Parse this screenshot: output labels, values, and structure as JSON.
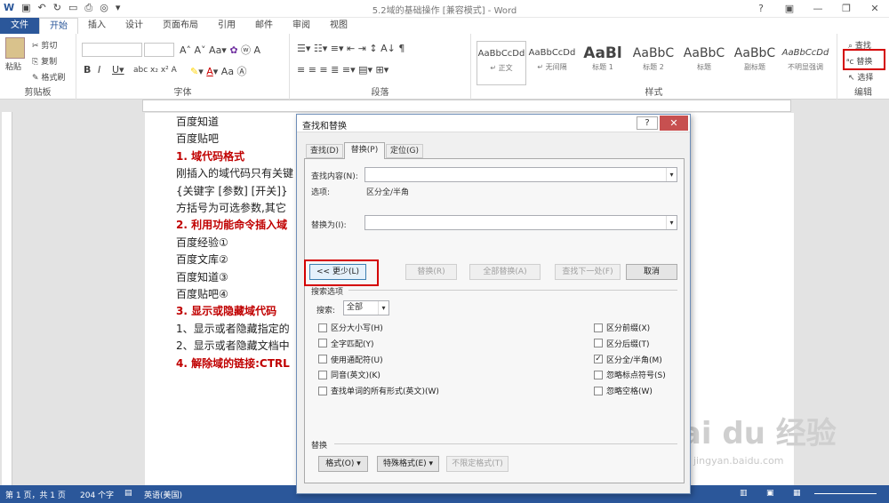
{
  "window": {
    "title": "5.2域的基础操作 [兼容模式] - Word"
  },
  "tabs": [
    "文件",
    "开始",
    "插入",
    "设计",
    "页面布局",
    "引用",
    "邮件",
    "审阅",
    "视图"
  ],
  "ribbon": {
    "clipboard": {
      "label": "剪贴板",
      "paste": "粘贴",
      "cut": "剪切",
      "copy": "复制",
      "format_painter": "格式刷"
    },
    "font": {
      "label": "字体"
    },
    "paragraph": {
      "label": "段落"
    },
    "styles": {
      "label": "样式",
      "items": [
        {
          "preview": "AaBbCcDd",
          "name": "↵ 正文"
        },
        {
          "preview": "AaBbCcDd",
          "name": "↵ 无间隔"
        },
        {
          "preview": "AaBl",
          "name": "标题 1"
        },
        {
          "preview": "AaBbC",
          "name": "标题 2"
        },
        {
          "preview": "AaBbC",
          "name": "标题"
        },
        {
          "preview": "AaBbC",
          "name": "副标题"
        },
        {
          "preview": "AaBbCcDd",
          "name": "不明显强调"
        }
      ]
    },
    "editing": {
      "label": "编辑",
      "find": "查找",
      "replace": "替换",
      "select": "选择"
    }
  },
  "document": {
    "lines": [
      {
        "text": "百度知道",
        "style": "normal"
      },
      {
        "text": "百度贴吧",
        "style": "normal"
      },
      {
        "text": "1.    域代码格式",
        "style": "red"
      },
      {
        "text": "刚插入的域代码只有关键",
        "style": "normal"
      },
      {
        "text": "{关键字  [参数] [开关]}",
        "style": "normal"
      },
      {
        "text": "方括号为可选参数,其它",
        "style": "normal"
      },
      {
        "text": "2.    利用功能命令插入域",
        "style": "red"
      },
      {
        "text": "百度经验①",
        "style": "normal"
      },
      {
        "text": "百度文库②",
        "style": "normal"
      },
      {
        "text": "百度知道③",
        "style": "normal"
      },
      {
        "text": "百度贴吧④",
        "style": "normal"
      },
      {
        "text": "3.    显示或隐藏域代码",
        "style": "red"
      },
      {
        "text": "1、显示或者隐藏指定的",
        "style": "normal"
      },
      {
        "text": "2、显示或者隐藏文档中",
        "style": "normal"
      },
      {
        "text": "4.    解除域的链接:CTRL",
        "style": "red"
      }
    ]
  },
  "status": {
    "page": "第 1 页，共 1 页",
    "words": "204 个字",
    "lang": "英语(美国)"
  },
  "dialog": {
    "title": "查找和替换",
    "help": "?",
    "tabs": [
      "查找(D)",
      "替换(P)",
      "定位(G)"
    ],
    "find_label": "查找内容(N):",
    "find_value": "",
    "options_label": "选项:",
    "options_value": "区分全/半角",
    "replace_label": "替换为(I):",
    "replace_value": "",
    "buttons": {
      "less": "<< 更少(L)",
      "replace": "替换(R)",
      "replace_all": "全部替换(A)",
      "find_next": "查找下一处(F)",
      "cancel": "取消"
    },
    "search_options_label": "搜索选项",
    "search_label": "搜索:",
    "search_value": "全部",
    "left_checks": [
      {
        "label": "区分大小写(H)",
        "checked": false
      },
      {
        "label": "全字匹配(Y)",
        "checked": false
      },
      {
        "label": "使用通配符(U)",
        "checked": false
      },
      {
        "label": "同音(英文)(K)",
        "checked": false
      },
      {
        "label": "查找单词的所有形式(英文)(W)",
        "checked": false
      }
    ],
    "right_checks": [
      {
        "label": "区分前缀(X)",
        "checked": false
      },
      {
        "label": "区分后缀(T)",
        "checked": false
      },
      {
        "label": "区分全/半角(M)",
        "checked": true
      },
      {
        "label": "忽略标点符号(S)",
        "checked": false
      },
      {
        "label": "忽略空格(W)",
        "checked": false
      }
    ],
    "replace_section": "替换",
    "format_btn": "格式(O) ▾",
    "special_btn": "特殊格式(E) ▾",
    "no_format_btn": "不限定格式(T)"
  },
  "watermark": {
    "logo": "Bai du 经验",
    "url": "jingyan.baidu.com"
  }
}
